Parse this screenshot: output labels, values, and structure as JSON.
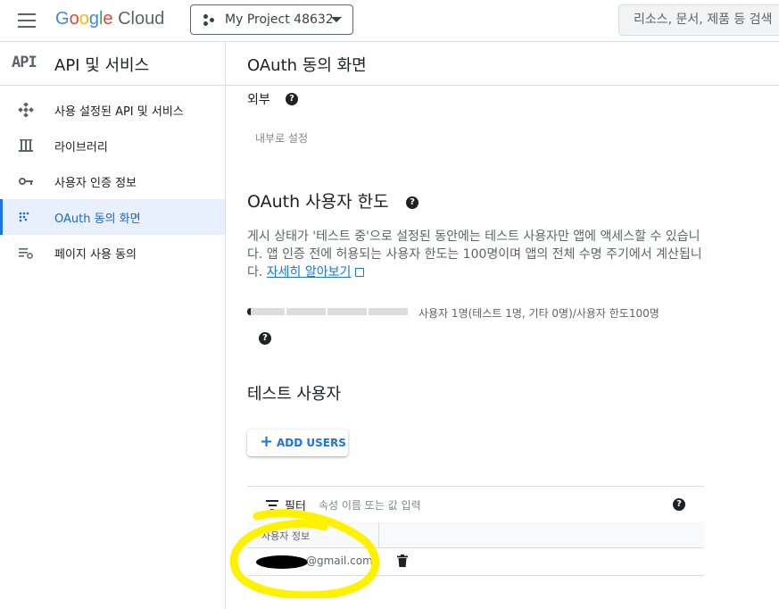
{
  "topbar": {
    "logo_google": "Google",
    "logo_cloud": "Cloud",
    "project_name": "My Project 48632",
    "search_placeholder": "리소스, 문서, 제품 등 검색"
  },
  "sidebar": {
    "badge": "API",
    "title": "API 및 서비스",
    "items": [
      {
        "label": "사용 설정된 API 및 서비스",
        "icon": "api-diamond-icon"
      },
      {
        "label": "라이브러리",
        "icon": "library-icon"
      },
      {
        "label": "사용자 인증 정보",
        "icon": "key-icon"
      },
      {
        "label": "OAuth 동의 화면",
        "icon": "consent-dots-icon",
        "active": true
      },
      {
        "label": "페이지 사용 동의",
        "icon": "page-settings-icon"
      }
    ]
  },
  "main": {
    "page_title": "OAuth 동의 화면",
    "user_type": "외부",
    "set_internal": "내부로 설정",
    "cap_title": "OAuth 사용자 한도",
    "cap_desc": "게시 상태가 '테스트 중'으로 설정된 동안에는 테스트 사용자만 앱에 액세스할 수 있습니다. 앱 인증 전에 허용되는 사용자 한도는 100명이며 앱의 전체 수명 주기에서 계산됩니다.",
    "learn_more": "자세히 알아보기",
    "usage_text": "사용자 1명(테스트 1명, 기타 0명)/사용자 한도100명",
    "usage_fraction": 0.01,
    "test_users_title": "테스트 사용자",
    "add_users_label": "ADD USERS",
    "filter_label": "필터",
    "filter_placeholder": "속성 이름 또는 값 입력",
    "column_header": "사용자 정보",
    "rows": [
      {
        "email": "@gmail.com"
      }
    ]
  },
  "colors": {
    "accent": "#1a73e8",
    "active_bg": "#e8f0fe",
    "highlight": "#fff200"
  }
}
